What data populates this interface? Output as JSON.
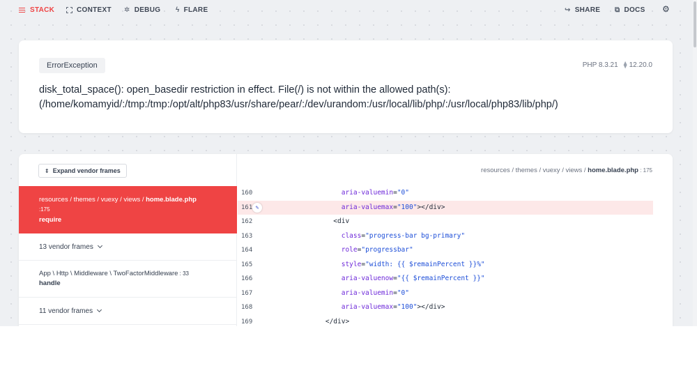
{
  "nav": {
    "stack": "STACK",
    "context": "CONTEXT",
    "debug": "DEBUG",
    "flare": "FLARE",
    "share": "SHARE",
    "docs": "DOCS",
    "settings_icon": "gear-icon"
  },
  "error": {
    "exception_class": "ErrorException",
    "php_version": "PHP 8.3.21",
    "laravel_version": "12.20.0",
    "message_line1": "disk_total_space(): open_basedir restriction in effect. File(/) is not within the allowed path(s):",
    "message_line2": "(/home/komamyid/:/tmp:/tmp:/opt/alt/php83/usr/share/pear/:/dev/urandom:/usr/local/lib/php/:/usr/local/php83/lib/php/)"
  },
  "frames": {
    "expand_label": "Expand vendor frames",
    "active": {
      "path_prefix": "resources / themes / vuexy / views / ",
      "file": "home.blade.php",
      "line": ":175",
      "fn": "require"
    },
    "vendor1": "13 vendor frames",
    "middleware": {
      "path": "App \\ Http \\ Middleware \\ TwoFactorMiddleware",
      "line": " : 33",
      "fn": "handle"
    },
    "vendor2": "11 vendor frames"
  },
  "code": {
    "path_prefix": "resources / themes / vuexy / views / ",
    "file": "home.blade.php",
    "line": " : 175",
    "highlight_line": 161,
    "lines": [
      {
        "n": "160",
        "indent": "                          ",
        "parts": [
          [
            "attr",
            "aria-valuemin"
          ],
          [
            "tag",
            "="
          ],
          [
            "str",
            "\"0\""
          ]
        ]
      },
      {
        "n": "161",
        "indent": "                          ",
        "parts": [
          [
            "attr",
            "aria-valuemax"
          ],
          [
            "tag",
            "="
          ],
          [
            "str",
            "\"100\""
          ],
          [
            "tag",
            "></div>"
          ]
        ]
      },
      {
        "n": "162",
        "indent": "                        ",
        "parts": [
          [
            "tag",
            "<div"
          ]
        ]
      },
      {
        "n": "163",
        "indent": "                          ",
        "parts": [
          [
            "attr",
            "class"
          ],
          [
            "tag",
            "="
          ],
          [
            "str",
            "\"progress-bar bg-primary\""
          ]
        ]
      },
      {
        "n": "164",
        "indent": "                          ",
        "parts": [
          [
            "attr",
            "role"
          ],
          [
            "tag",
            "="
          ],
          [
            "str",
            "\"progressbar\""
          ]
        ]
      },
      {
        "n": "165",
        "indent": "                          ",
        "parts": [
          [
            "attr",
            "style"
          ],
          [
            "tag",
            "="
          ],
          [
            "str",
            "\"width: {{ $remainPercent }}%\""
          ]
        ]
      },
      {
        "n": "166",
        "indent": "                          ",
        "parts": [
          [
            "attr",
            "aria-valuenow"
          ],
          [
            "tag",
            "="
          ],
          [
            "str",
            "\"{{ $remainPercent }}\""
          ]
        ]
      },
      {
        "n": "167",
        "indent": "                          ",
        "parts": [
          [
            "attr",
            "aria-valuemin"
          ],
          [
            "tag",
            "="
          ],
          [
            "str",
            "\"0\""
          ]
        ]
      },
      {
        "n": "168",
        "indent": "                          ",
        "parts": [
          [
            "attr",
            "aria-valuemax"
          ],
          [
            "tag",
            "="
          ],
          [
            "str",
            "\"100\""
          ],
          [
            "tag",
            "></div>"
          ]
        ]
      },
      {
        "n": "169",
        "indent": "                      ",
        "parts": [
          [
            "tag",
            "</div>"
          ]
        ]
      }
    ]
  }
}
